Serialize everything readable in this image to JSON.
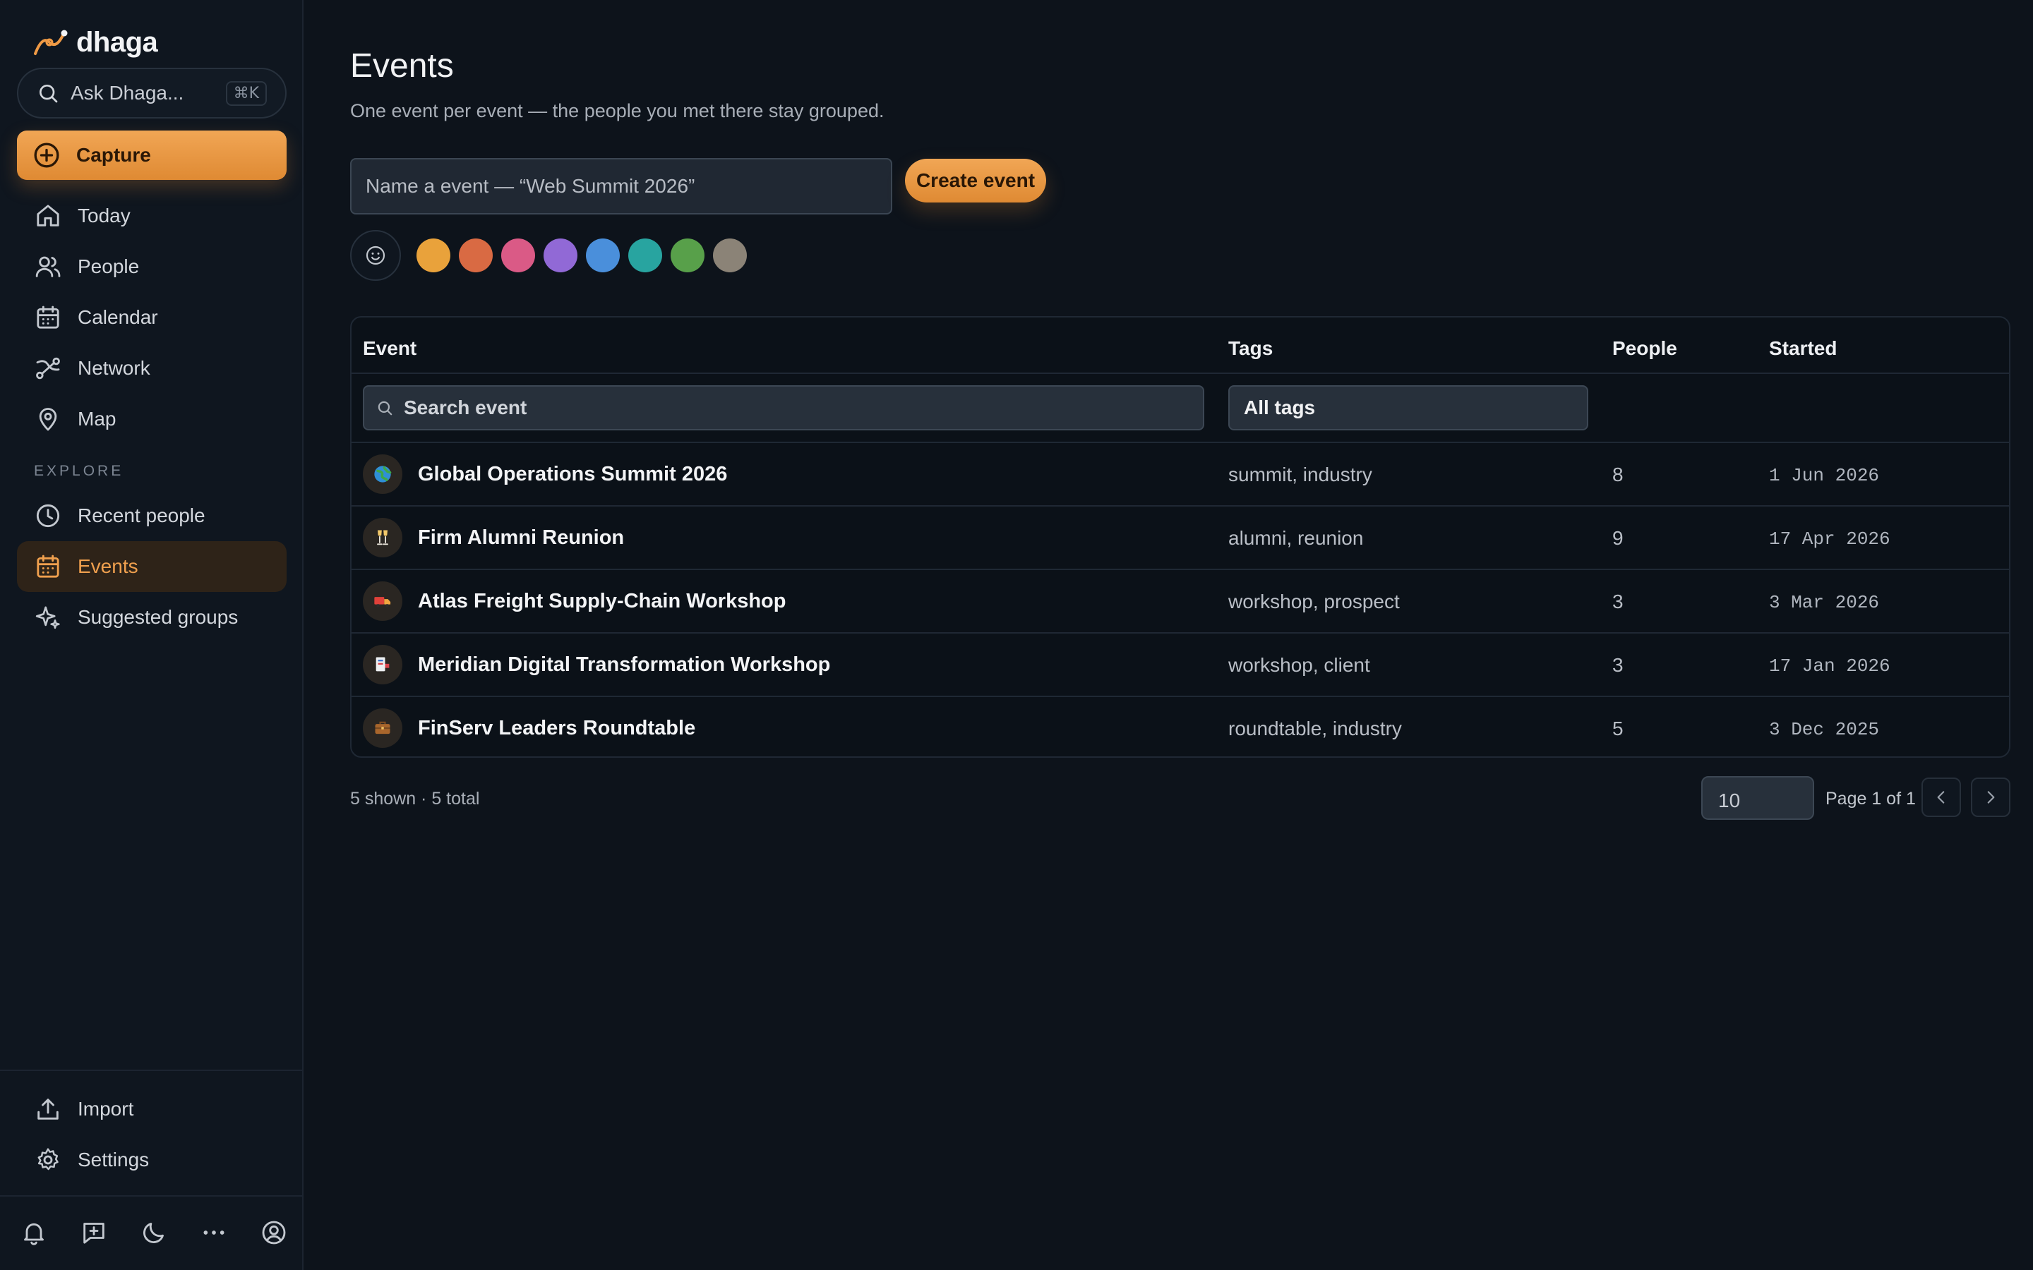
{
  "app": {
    "name": "dhaga"
  },
  "sidebar": {
    "ask": {
      "label": "Ask Dhaga...",
      "shortcut": "⌘K"
    },
    "capture_label": "Capture",
    "nav": [
      {
        "label": "Today",
        "icon": "home-icon"
      },
      {
        "label": "People",
        "icon": "people-icon"
      },
      {
        "label": "Calendar",
        "icon": "calendar-icon"
      },
      {
        "label": "Network",
        "icon": "network-icon"
      },
      {
        "label": "Map",
        "icon": "map-pin-icon"
      }
    ],
    "explore_label": "EXPLORE",
    "explore": [
      {
        "label": "Recent people",
        "icon": "clock-icon"
      },
      {
        "label": "Events",
        "icon": "calendar-icon",
        "active": true
      },
      {
        "label": "Suggested groups",
        "icon": "sparkles-icon"
      }
    ],
    "bottom": [
      {
        "label": "Import",
        "icon": "upload-icon"
      },
      {
        "label": "Settings",
        "icon": "gear-icon"
      }
    ],
    "footer_icons": [
      "bell-icon",
      "add-message-icon",
      "moon-icon",
      "more-icon",
      "account-icon"
    ]
  },
  "main": {
    "title": "Events",
    "subtitle": "One event per event — the people you met there stay grouped.",
    "new_event": {
      "placeholder": "Name a event — “Web Summit 2026”",
      "create_label": "Create event",
      "colors": [
        "#e9a23b",
        "#d96a43",
        "#da5a86",
        "#9169d6",
        "#4a8fdb",
        "#28a4a0",
        "#58a04a",
        "#8b8377"
      ]
    },
    "table": {
      "headers": {
        "event": "Event",
        "tags": "Tags",
        "people": "People",
        "started": "Started"
      },
      "search_placeholder": "Search event",
      "tags_filter": "All tags",
      "rows": [
        {
          "name": "Global Operations Summit 2026",
          "icon": "globe-icon",
          "tags": "summit, industry",
          "people": "8",
          "started": "1 Jun 2026"
        },
        {
          "name": "Firm Alumni Reunion",
          "icon": "champagne-icon",
          "tags": "alumni, reunion",
          "people": "9",
          "started": "17 Apr 2026"
        },
        {
          "name": "Atlas Freight Supply-Chain Workshop",
          "icon": "truck-icon",
          "tags": "workshop, prospect",
          "people": "3",
          "started": "3 Mar 2026"
        },
        {
          "name": "Meridian Digital Transformation Workshop",
          "icon": "presentation-icon",
          "tags": "workshop, client",
          "people": "3",
          "started": "17 Jan 2026"
        },
        {
          "name": "FinServ Leaders Roundtable",
          "icon": "briefcase-icon",
          "tags": "roundtable, industry",
          "people": "5",
          "started": "3 Dec 2025"
        }
      ]
    },
    "footer": {
      "count": "5 shown · 5 total",
      "per_page": "10",
      "page": "Page 1 of 1"
    }
  }
}
